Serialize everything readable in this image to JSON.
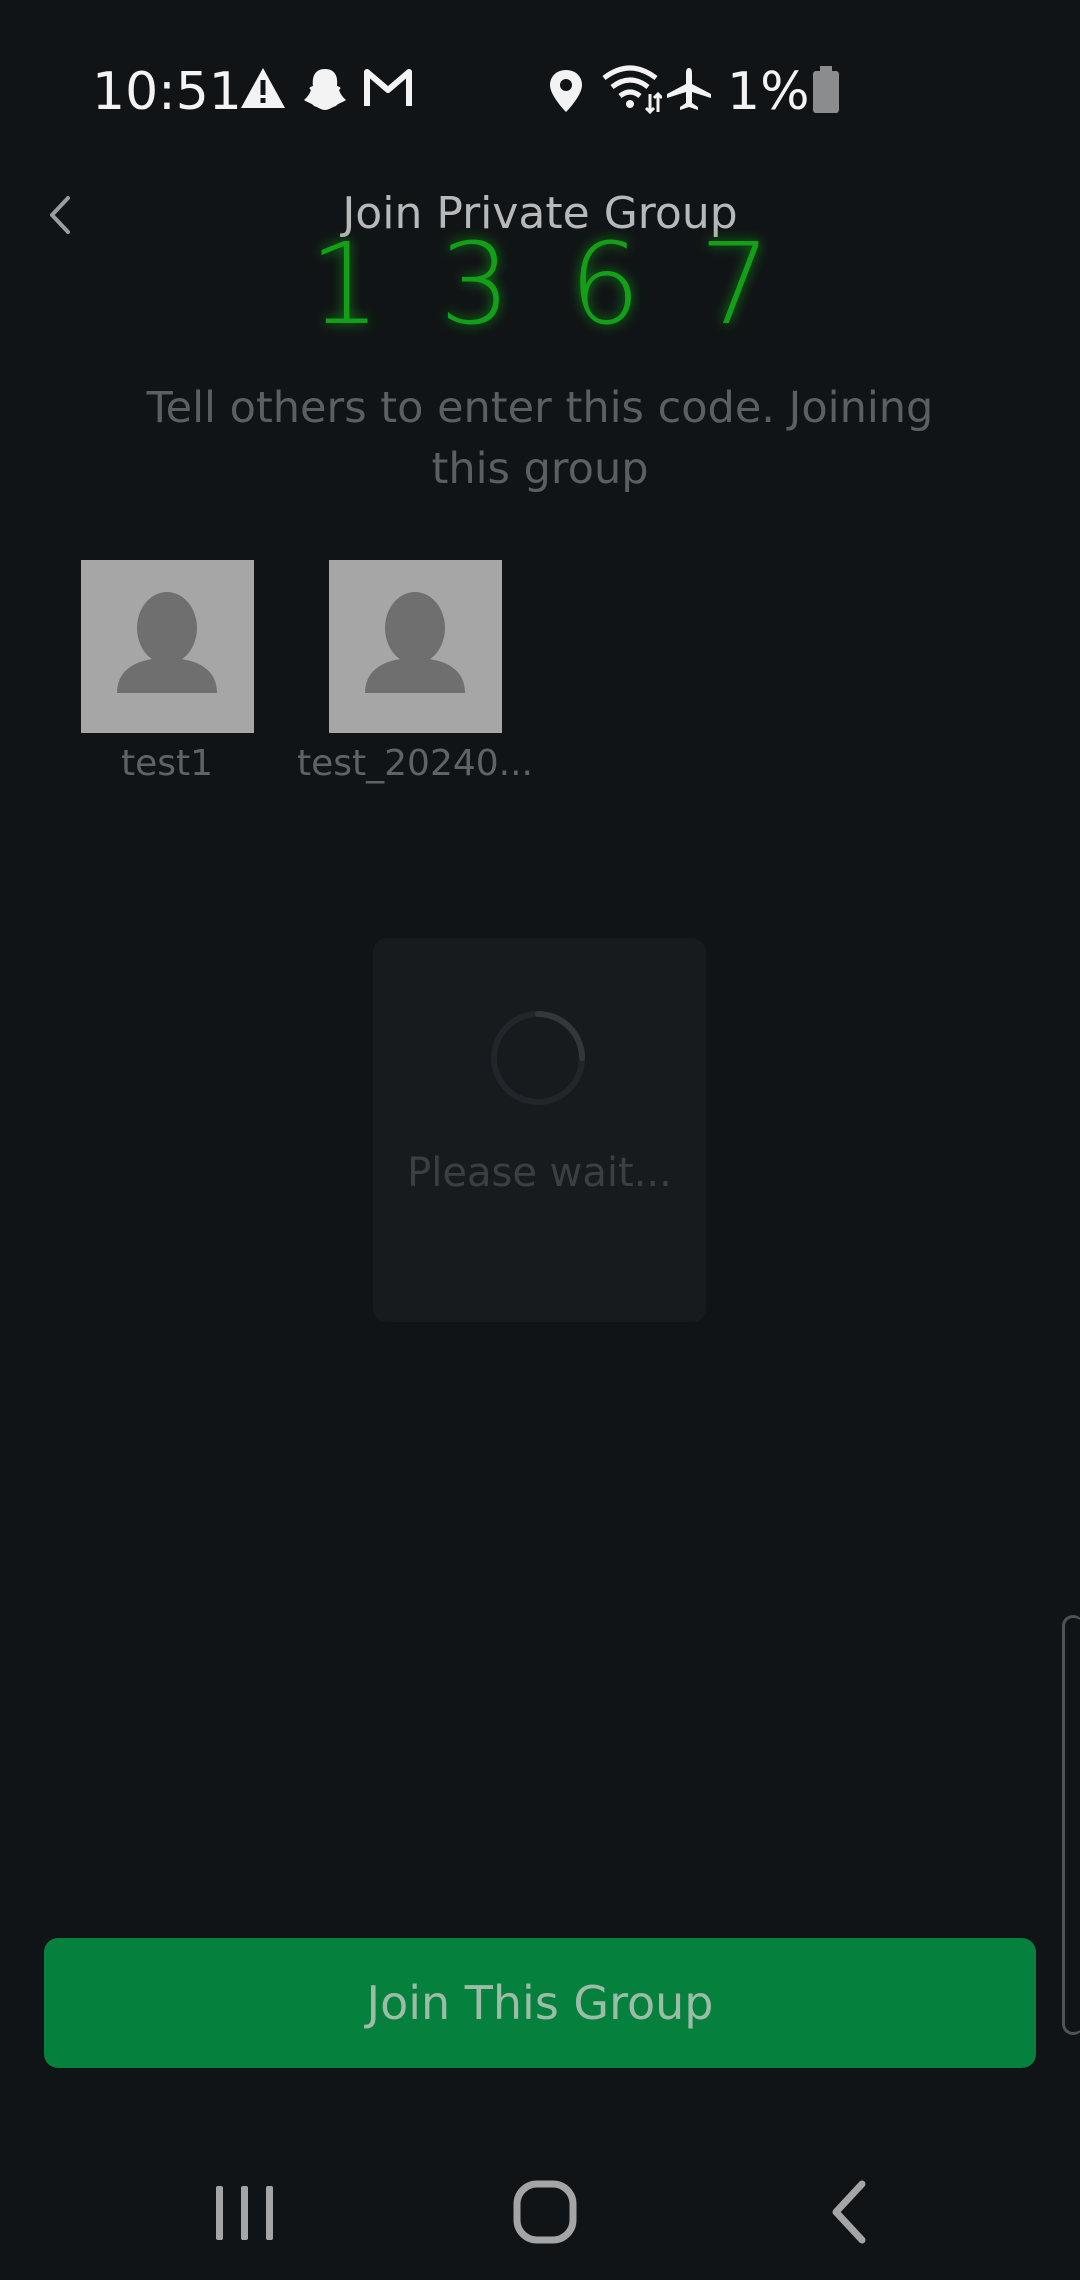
{
  "status_bar": {
    "time": "10:51",
    "battery_percent": "1%",
    "notification_icons": [
      "warning-icon",
      "snapchat-icon",
      "gmail-icon"
    ],
    "system_icons": [
      "location-icon",
      "wifi-icon",
      "airplane-icon",
      "battery-icon"
    ]
  },
  "header": {
    "title": "Join Private Group",
    "back_icon": "chevron-left-icon"
  },
  "code": {
    "digits": [
      "1",
      "3",
      "6",
      "7"
    ],
    "color": "#13a018"
  },
  "instructions": "Tell others to enter this code. Joining this group",
  "members": [
    {
      "name": "test1",
      "avatar_icon": "person-placeholder-icon"
    },
    {
      "name": "test_20240...",
      "avatar_icon": "person-placeholder-icon"
    }
  ],
  "loading": {
    "text": "Please wait..."
  },
  "actions": {
    "join_label": "Join This Group",
    "join_color": "#05803d"
  },
  "nav_bar": {
    "buttons": [
      "recent-apps-icon",
      "home-icon",
      "back-icon"
    ]
  }
}
